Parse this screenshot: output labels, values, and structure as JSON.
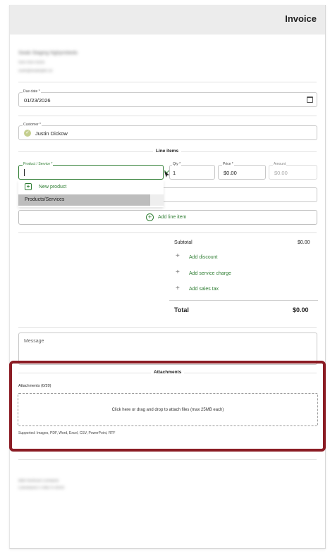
{
  "header": {
    "title": "Invoice"
  },
  "company": {
    "name": "Swab Staging Nghjsmbeds",
    "phone": "555-555-5555",
    "email": "user@example.co"
  },
  "due_date": {
    "label": "Due date *",
    "value": "01/23/2026"
  },
  "customer": {
    "label": "Customer *",
    "value": "Justin Dickow"
  },
  "line_items": {
    "heading": "Line items",
    "product_label": "Product / Service *",
    "qty_label": "Qty *",
    "qty_value": "1",
    "price_label": "Price *",
    "price_value": "$0.00",
    "amount_label": "Amount",
    "amount_value": "$0.00",
    "dropdown": {
      "new_product": "New product",
      "section": "Products/Services"
    },
    "add_line_item": "Add line item"
  },
  "summary": {
    "subtotal_label": "Subtotal",
    "subtotal_value": "$0.00",
    "add_discount": "Add discount",
    "add_service_charge": "Add service charge",
    "add_sales_tax": "Add sales tax",
    "total_label": "Total",
    "total_value": "$0.00"
  },
  "message": {
    "placeholder": "Message"
  },
  "attachments": {
    "heading": "Attachments",
    "count_label": "Attachments (0/20)",
    "dropzone_text": "Click here or drag and drop to attach files (max 25MB each)",
    "supported": "Supported: Images, PDF, Word, Excel, CSV, PowerPoint, RTF"
  },
  "footer": {
    "line1": "888 Nortical Contacts",
    "line2": "Cleveland 0 44870-4000"
  },
  "colors": {
    "accent": "#2e7d32",
    "highlight": "#8b1c24"
  }
}
